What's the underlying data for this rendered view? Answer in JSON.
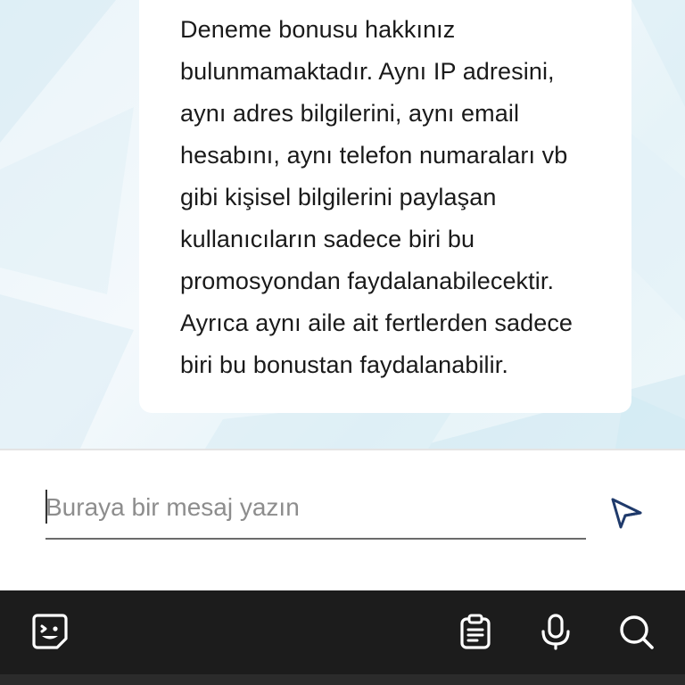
{
  "message": {
    "text": "Deneme bonusu hakkınız\nbulunmamaktadır. Aynı IP adresini,\naynı adres bilgilerini, aynı email\nhesabını, aynı telefon numaraları vb\ngibi kişisel bilgilerini paylaşan\nkullanıcıların sadece biri bu\npromosyondan faydalanabilecektir.\nAyrıca aynı aile ait fertlerden sadece\nbiri bu bonustan faydalanabilir."
  },
  "composer": {
    "placeholder": "Buraya bir mesaj yazın",
    "value": "",
    "send_icon": "send-icon"
  },
  "toolbar": {
    "icons": [
      "sticker-icon",
      "clipboard-icon",
      "microphone-icon",
      "search-icon"
    ]
  },
  "colors": {
    "accent": "#1f3a6b",
    "toolbar_bg": "#1c1c1c",
    "bubble_bg": "#ffffff",
    "text": "#1a1a1a",
    "placeholder": "#8d8d8d"
  }
}
